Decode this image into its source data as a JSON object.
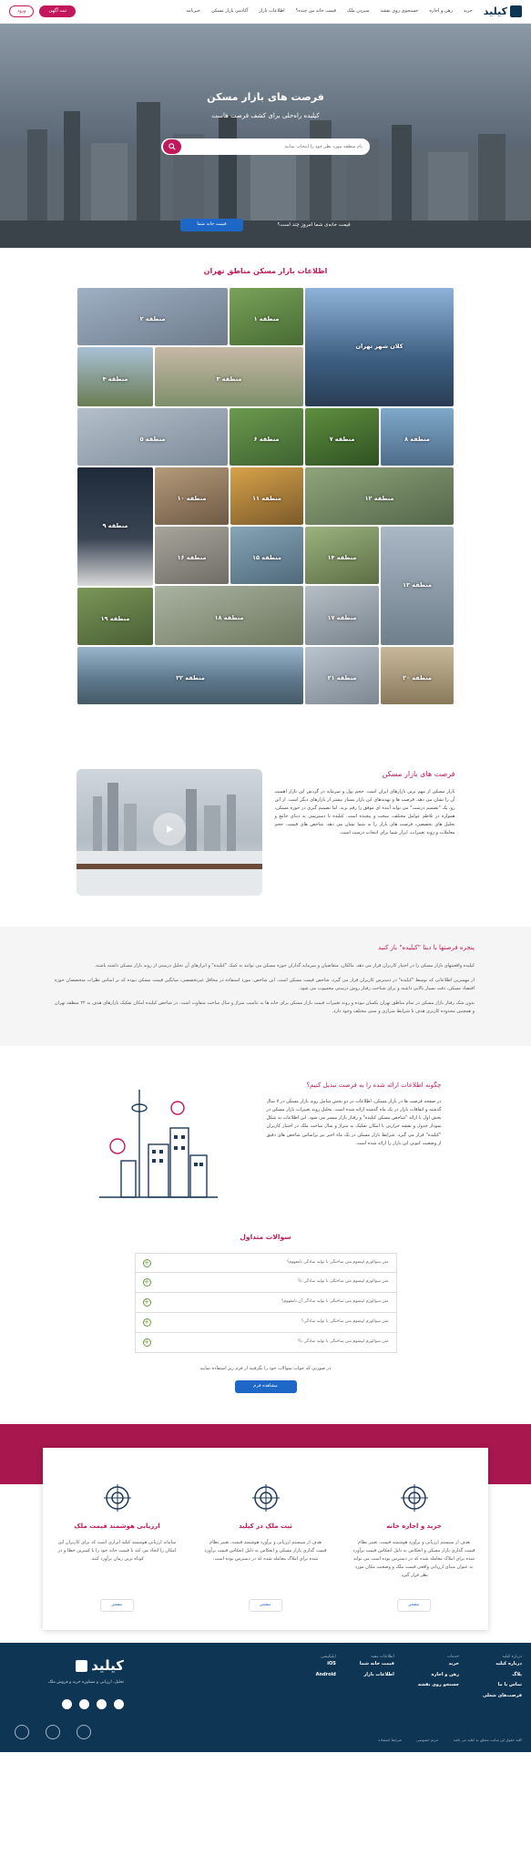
{
  "header": {
    "nav": [
      "خرید",
      "رهن و اجاره",
      "جستجوی روی نقشه",
      "سپردن ملک",
      "قیمت خانه من چنده؟",
      "اطلاعات بازار",
      "آکادمی بازار مسکن",
      "خبرنامه"
    ],
    "login": "ورود",
    "cta": "ثبت آگهی"
  },
  "hero": {
    "title": "فرصت های بازار مسکن",
    "subtitle": "کیلیده راه‌حلی برای کشف فرصت هاست",
    "search_placeholder": "نام منطقه مورد نظر خود را انتخاب نمایید",
    "question": "قیمت خانه‌ی شما امروز چند است؟",
    "button": "قیمت خانه شما"
  },
  "districts": {
    "title": "اطلاعات بازار مسکن مناطق تهران",
    "tiles": [
      "کلان شهر تهران",
      "منطقه ۱",
      "منطقه ۲",
      "منطقه ۳",
      "منطقه ۴",
      "منطقه ۵",
      "منطقه ۶",
      "منطقه ۷",
      "منطقه ۸",
      "منطقه ۹",
      "منطقه ۱۰",
      "منطقه ۱۱",
      "منطقه ۱۲",
      "منطقه ۱۳",
      "منطقه ۱۴",
      "منطقه ۱۵",
      "منطقه ۱۶",
      "منطقه ۱۷",
      "منطقه ۱۸",
      "منطقه ۱۹",
      "منطقه ۲۰",
      "منطقه ۲۱",
      "منطقه ۲۲"
    ]
  },
  "opportunities": {
    "title": "فرصت های بازار مسکن",
    "body": "بازار مسکن از مهم ترین بازارهای ایران است. حجم پول و سرمایه در گردش این بازار اهمیت آن را نشان می دهد. فرصت ها و تهدیدهای این بازار بسیار بیشتر از بازارهای دیگر است. از این رو، یک \"تصمیم درست\" می تواند آینده ای موفق را رقم بزند. اما تصمیم گیری در حوزه مسکن، همواره در تلاطم عوامل مختلف، سخت و پیچیده است. کیلیده با دسترسی به دیتای جامع و تحلیل های تخصصی، فرصت های بازار را به شما نشان می دهد. شاخص های قیمت، حجم معاملات و روند تغییرات، ابزار شما برای انتخاب درست است."
  },
  "window": {
    "title": "پنجره فرصتها با دیتا \"کیلیده\" باز کنید",
    "p1": "کیلیده واقعیتهای بازار مسکن را در اختیار کاربران قرار می دهد. مالکان، متقاضیان و سرمایه گذاران حوزه مسکن می توانند به کمک \"کیلیده\" و ابزارهای آن تحلیل درستی از روند بازار مسکن داشته باشند.",
    "p2": "از مهمترین اطلاعاتی که توسط \"کیلیده\" در دسترس کاربران قرار می گیرد، شاخص قیمت مسکن است. این شاخص، مورد استفاده در محافل غیرتخصصی، میانگین قیمت مسکن نبوده که بر اساس نظرات متخصصان حوزه اقتصاد مسکن، دقت بسیار بالایی داشته و برای شناخت رفتار روش درستی محسوب می شود.",
    "p3": "بدون شک رفتار بازار مسکن در تمام مناطق تهران یکسان نبوده و روند تغییرات قیمت بازار مسکن برای خانه ها به تناسب متراژ و سال ساخت متفاوت است. در شاخص کیلیده امکان تفکیک بازارهای هدف به ۲۲ منطقه تهران و همچنین محدوده کاربری هدف با شرایط متراژی و سنی مختلف وجود دارد."
  },
  "how": {
    "title": "چگونه اطلاعات ارائه شده را به فرصت تبدیل کنیم؟",
    "body": "در صفحه فرصت ها در بازار مسکن، اطلاعات در دو بخش شامل روند بازار مسکن در ۷ سال گذشته و اتفاقات بازار در یک ماه گذشته ارائه شده است. تحلیل روند تغییرات بازار مسکن در بخش اول با ارائه \"شاخص مسکن کیلیده\" و رفتار بازار میسر می شود. این اطلاعات به شکل نمودار جدول و نقشه حرارتی با امکان تفکیک به متراژ و سال ساخت ملک در اختیار کاربران \"کیلیده\" قرار می گیرد. شرایط بازار مسکن در یک ماه اخیر نیز براساس شاخص های دقیق از وضعیت کنونی این بازار را ارائه شده است."
  },
  "faq": {
    "title": "سوالات متداول",
    "items": [
      "متن سوالورم ایپسوم متن ساختگی با تولید سادگی نامفهوم؟",
      "متن سوالورم ایپسوم متن ساختگی با تولید سادگی نا؟",
      "متن سوالورم ایپسوم متن ساختگی با تولید سادگی آن نامفهوم؟",
      "متن سوالورم ایپسوم متن ساختگی با تولید سادگی؟",
      "متن سوالورم ایپسوم متن ساختگی با تولید سادگی نا؟"
    ],
    "note": "در صورتی که جواب سوالات خود را نگرفتید از فرم زیر استفاده نمایید",
    "button": "مشاهده فرم"
  },
  "services": [
    {
      "title": "خرید و اجاره خانه",
      "body": "هدف از سیستم ارزیابی و برآورد هوشمند قیمت، تغییر نظام قیمت گذاری بازار مسکن و انعکاس به دلیل انعکاس قیمت برآورد شده برای املاک معامله شده که در دسترس بوده است می تواند به عنوان مبنای ارزیابی واقعی قیمت ملک و وضعیت مکان مورد نظر قرار گیرد.",
      "button": "بیشتر"
    },
    {
      "title": "ثبت ملک در کیلید",
      "body": "هدف از سیستم ارزیابی و برآورد هوشمند قیمت، تغییر نظام قیمت گذاری بازار مسکن و انعکاس به دلیل انعکاس قیمت برآورد شده برای املاک معامله شده که در دسترس بوده است.",
      "button": "بیشتر"
    },
    {
      "title": "ارزیابی هوشمند قیمت ملک",
      "body": "سامانه ارزیابی هوشمند کیلید ابزاری است که برای کاربران این امکان را ایجاد می کند تا قیمت خانه خود را با کمترین خطا و در کوتاه ترین زمان برآورد کنند.",
      "button": "بیشتر"
    }
  ],
  "footer": {
    "brand_tagline": "تحلیل، ارزیابی و مشاوره خرید و فروش ملک",
    "col1_head": "خدمات",
    "col1": [
      "خرید",
      "رهن و اجاره",
      "جستجو روی نقشه"
    ],
    "col2_head": "اطلاعات مفید",
    "col2": [
      "قیمت خانه شما",
      "اطلاعات بازار"
    ],
    "col3_head": "اپلیکیشن",
    "col3": [
      "iOS",
      "Android"
    ],
    "col4_head": "درباره کیلید",
    "col4": [
      "درباره کیلید",
      "بلاگ",
      "تماس با ما",
      "فرصت‌های شغلی"
    ],
    "bottom": [
      "حریم خصوصی",
      "شرایط استفاده",
      "کلیه حقوق این سایت متعلق به کیلید می باشد"
    ]
  }
}
